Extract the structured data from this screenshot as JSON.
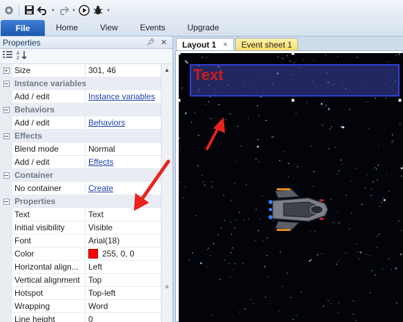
{
  "toolbar": {
    "icons": [
      "gear-icon",
      "save-icon",
      "undo-icon",
      "redo-icon",
      "run-icon",
      "debug-icon",
      "customize-icon"
    ]
  },
  "ribbon": {
    "file_label": "File",
    "tabs": [
      "Home",
      "View",
      "Events",
      "Upgrade"
    ]
  },
  "properties": {
    "title": "Properties",
    "rows": [
      {
        "type": "prop",
        "expander": "+",
        "key": "Size",
        "value": "301, 46"
      },
      {
        "type": "cat",
        "label": "Instance variables"
      },
      {
        "type": "prop",
        "key": "Add / edit",
        "value": "Instance variables",
        "link": true
      },
      {
        "type": "cat",
        "label": "Behaviors"
      },
      {
        "type": "prop",
        "key": "Add / edit",
        "value": "Behaviors",
        "link": true
      },
      {
        "type": "cat",
        "label": "Effects"
      },
      {
        "type": "prop",
        "key": "Blend mode",
        "value": "Normal"
      },
      {
        "type": "prop",
        "key": "Add / edit",
        "value": "Effects",
        "link": true
      },
      {
        "type": "cat",
        "label": "Container"
      },
      {
        "type": "prop",
        "key": "No container",
        "value": "Create",
        "link": true
      },
      {
        "type": "cat",
        "label": "Properties"
      },
      {
        "type": "prop",
        "key": "Text",
        "value": "Text"
      },
      {
        "type": "prop",
        "key": "Initial visibility",
        "value": "Visible"
      },
      {
        "type": "prop",
        "key": "Font",
        "value": "Arial(18)"
      },
      {
        "type": "prop",
        "key": "Color",
        "value": "255, 0, 0",
        "swatch": "#ff0000"
      },
      {
        "type": "prop",
        "key": "Horizontal align...",
        "value": "Left"
      },
      {
        "type": "prop",
        "key": "Vertical alignment",
        "value": "Top"
      },
      {
        "type": "prop",
        "key": "Hotspot",
        "value": "Top-left"
      },
      {
        "type": "prop",
        "key": "Wrapping",
        "value": "Word"
      },
      {
        "type": "prop",
        "key": "Line height",
        "value": "0"
      }
    ]
  },
  "editor": {
    "tabs": [
      {
        "label": "Layout 1",
        "active": true,
        "close": "×"
      },
      {
        "label": "Event sheet 1",
        "active": false
      }
    ],
    "text_object": "Text"
  },
  "colors": {
    "arrow": "#e8231b",
    "text_object_fill": "#3c46aa",
    "text_color": "#cc1d1d"
  }
}
